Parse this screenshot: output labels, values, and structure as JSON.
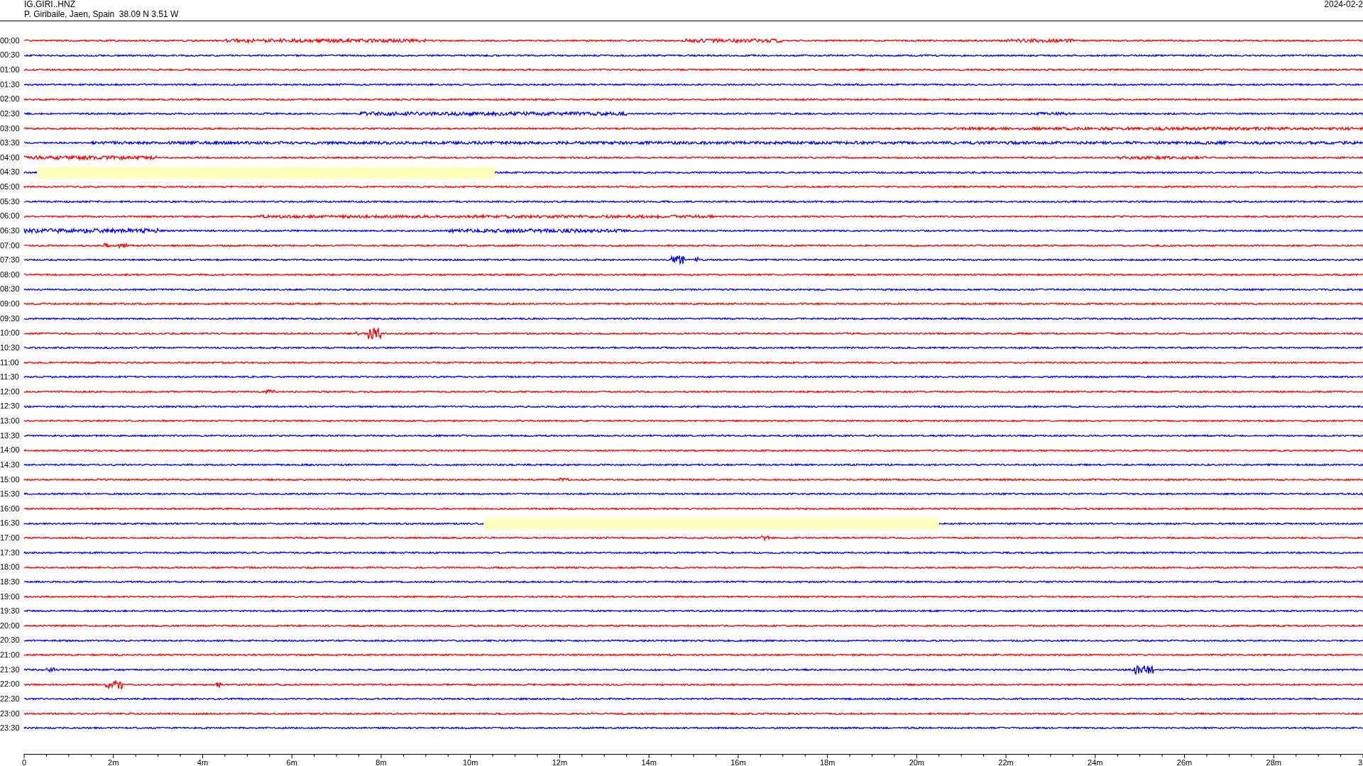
{
  "header": {
    "station": "IG.GIRI..HNZ",
    "location": "P. Giribaile, Jaen, Spain  38.09 N 3.51 W",
    "date": "2024-02-2"
  },
  "rows": [
    {
      "label": "00:00",
      "color": "#ff0000"
    },
    {
      "label": "00:30",
      "color": "#0000ff"
    },
    {
      "label": "01:00",
      "color": "#ff0000"
    },
    {
      "label": "01:30",
      "color": "#0000ff"
    },
    {
      "label": "02:00",
      "color": "#ff0000"
    },
    {
      "label": "02:30",
      "color": "#0000ff"
    },
    {
      "label": "03:00",
      "color": "#ff0000"
    },
    {
      "label": "03:30",
      "color": "#0000ff"
    },
    {
      "label": "04:00",
      "color": "#ff0000"
    },
    {
      "label": "04:30",
      "color": "#0000ff",
      "gap": true
    },
    {
      "label": "05:00",
      "color": "#ff0000"
    },
    {
      "label": "05:30",
      "color": "#0000ff"
    },
    {
      "label": "06:00",
      "color": "#ff0000"
    },
    {
      "label": "06:30",
      "color": "#0000ff"
    },
    {
      "label": "07:00",
      "color": "#ff0000"
    },
    {
      "label": "07:30",
      "color": "#0000ff"
    },
    {
      "label": "08:00",
      "color": "#ff0000"
    },
    {
      "label": "08:30",
      "color": "#0000ff"
    },
    {
      "label": "09:00",
      "color": "#ff0000"
    },
    {
      "label": "09:30",
      "color": "#0000ff"
    },
    {
      "label": "10:00",
      "color": "#ff0000"
    },
    {
      "label": "10:30",
      "color": "#0000ff"
    },
    {
      "label": "11:00",
      "color": "#ff0000"
    },
    {
      "label": "11:30",
      "color": "#0000ff"
    },
    {
      "label": "12:00",
      "color": "#ff0000"
    },
    {
      "label": "12:30",
      "color": "#0000ff"
    },
    {
      "label": "13:00",
      "color": "#ff0000"
    },
    {
      "label": "13:30",
      "color": "#0000ff"
    },
    {
      "label": "14:00",
      "color": "#ff0000"
    },
    {
      "label": "14:30",
      "color": "#0000ff"
    },
    {
      "label": "15:00",
      "color": "#ff0000"
    },
    {
      "label": "15:30",
      "color": "#0000ff"
    },
    {
      "label": "16:00",
      "color": "#ff0000"
    },
    {
      "label": "16:30",
      "color": "#0000ff",
      "gap": true
    },
    {
      "label": "17:00",
      "color": "#ff0000"
    },
    {
      "label": "17:30",
      "color": "#0000ff"
    },
    {
      "label": "18:00",
      "color": "#ff0000"
    },
    {
      "label": "18:30",
      "color": "#0000ff"
    },
    {
      "label": "19:00",
      "color": "#ff0000"
    },
    {
      "label": "19:30",
      "color": "#0000ff"
    },
    {
      "label": "20:00",
      "color": "#ff0000"
    },
    {
      "label": "20:30",
      "color": "#0000ff"
    },
    {
      "label": "21:00",
      "color": "#ff0000"
    },
    {
      "label": "21:30",
      "color": "#0000ff"
    },
    {
      "label": "22:00",
      "color": "#ff0000"
    },
    {
      "label": "22:30",
      "color": "#0000ff"
    },
    {
      "label": "23:00",
      "color": "#ff0000"
    },
    {
      "label": "23:30",
      "color": "#0000ff"
    }
  ],
  "x_axis": {
    "labels": [
      "0",
      "2m",
      "4m",
      "6m",
      "8m",
      "10m",
      "12m",
      "14m",
      "16m",
      "18m",
      "20m",
      "22m",
      "24m",
      "26m",
      "28m",
      "3"
    ]
  }
}
